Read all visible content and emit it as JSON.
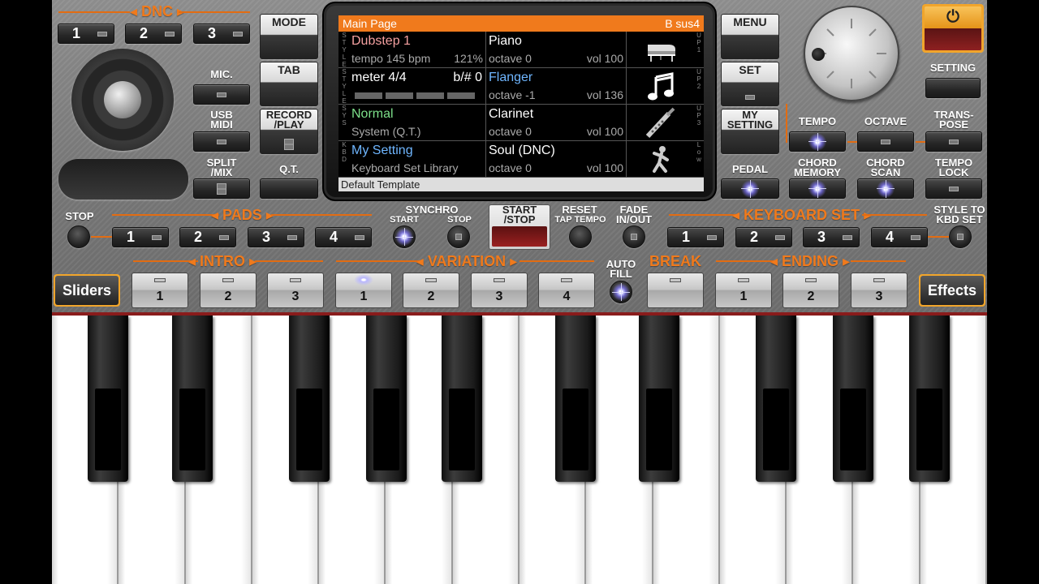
{
  "dnc": {
    "title": "DNC",
    "buttons": [
      "1",
      "2",
      "3"
    ]
  },
  "left_column": {
    "mic": "MIC.",
    "usb_midi": "USB\nMIDI",
    "split_mix": "SPLIT\n/MIX"
  },
  "mid_column": {
    "mode": "MODE",
    "tab": "TAB",
    "record_play": "RECORD\n/PLAY",
    "qt": "Q.T."
  },
  "display": {
    "header_title": "Main Page",
    "header_chord": "B sus4",
    "rows": [
      {
        "left_tag": "STYLE",
        "left_title": "Dubstep 1",
        "left_title_color": "#f4a0a0",
        "left_sub": "tempo 145 bpm",
        "left_sub_right": "121%",
        "mid_title": "Piano",
        "mid_title_color": "#ffffff",
        "mid_sub": "octave  0",
        "mid_vol": "vol 100",
        "icon": "grand-piano-icon",
        "right_tag": "UP1"
      },
      {
        "left_tag": "STYLE",
        "left_title": "meter 4/4",
        "left_title_right": "b/#  0",
        "left_title_color": "#ffffff",
        "mid_title": "Flanger",
        "mid_title_color": "#6fb6ff",
        "mid_sub": "octave -1",
        "mid_vol": "vol 136",
        "icon": "music-note-icon",
        "right_tag": "UP2"
      },
      {
        "left_tag": "SYS",
        "left_title": "Normal",
        "left_title_color": "#7de08a",
        "left_sub": "System (Q.T.)",
        "mid_title": "Clarinet",
        "mid_title_color": "#ffffff",
        "mid_sub": "octave  0",
        "mid_vol": "vol 100",
        "icon": "clarinet-icon",
        "right_tag": "UP3"
      },
      {
        "left_tag": "KBD",
        "left_title": "My Setting",
        "left_title_color": "#6fb6ff",
        "left_sub": "Keyboard Set Library",
        "mid_title": "Soul (DNC)",
        "mid_title_color": "#ffffff",
        "mid_sub": "octave  0",
        "mid_vol": "vol 100",
        "icon": "dancer-icon",
        "right_tag": "Low"
      }
    ],
    "footer": "Default Template"
  },
  "right_mid_column": {
    "menu": "MENU",
    "set": "SET",
    "my_setting": "MY\nSETTING",
    "pedal": "PEDAL"
  },
  "right_column": {
    "setting": "SETTING",
    "tempo": "TEMPO",
    "octave": "OCTAVE",
    "transpose": "TRANS-\nPOSE",
    "chord_memory": "CHORD\nMEMORY",
    "chord_scan": "CHORD\nSCAN",
    "tempo_lock": "TEMPO\nLOCK"
  },
  "row_pads": {
    "stop": "STOP",
    "pads_title": "PADS",
    "pads": [
      "1",
      "2",
      "3",
      "4"
    ],
    "synchro": "SYNCHRO",
    "synchro_start": "START",
    "synchro_stop": "STOP",
    "start_stop": "START\n/STOP",
    "reset": "RESET",
    "tap_tempo": "TAP TEMPO",
    "fade": "FADE\nIN/OUT",
    "keyboard_set_title": "KEYBOARD SET",
    "keyboard_set": [
      "1",
      "2",
      "3",
      "4"
    ],
    "style_to_kbd": "STYLE TO\nKBD SET"
  },
  "row_style": {
    "sliders": "Sliders",
    "intro_title": "INTRO",
    "intro": [
      "1",
      "2",
      "3"
    ],
    "variation_title": "VARIATION",
    "variation": [
      "1",
      "2",
      "3",
      "4"
    ],
    "auto_fill": "AUTO\nFILL",
    "break_title": "BREAK",
    "ending_title": "ENDING",
    "ending": [
      "1",
      "2",
      "3"
    ],
    "effects": "Effects"
  },
  "colors": {
    "accent": "#f07a1c",
    "power": "#f1a52b"
  }
}
